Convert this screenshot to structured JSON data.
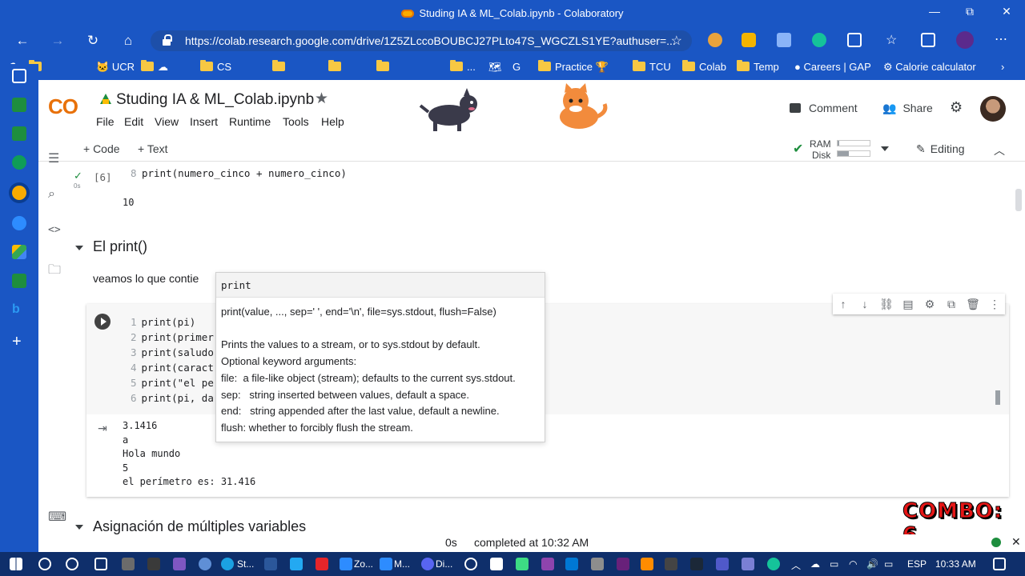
{
  "window": {
    "title": "Studing IA & ML_Colab.ipynb - Colaboratory",
    "minimize": "—",
    "restore": "⧉",
    "close": "✕"
  },
  "browser": {
    "url": "https://colab.research.google.com/drive/1Z5ZLccoBOUBCJ27PLto47S_WGCZLS1YE?authuser=...",
    "bookmarks": [
      "UCR",
      "CS",
      "...",
      "Practice",
      "TCU",
      "Colab",
      "Temp",
      "Careers | GAP",
      "Calorie calculator"
    ]
  },
  "colab": {
    "logo": "CO",
    "notebook_title": "Studing IA & ML_Colab.ipynb",
    "menu": [
      "File",
      "Edit",
      "View",
      "Insert",
      "Runtime",
      "Tools",
      "Help"
    ],
    "comment": "Comment",
    "share": "Share",
    "add_code": "+ Code",
    "add_text": "+ Text",
    "ram_label": "RAM",
    "disk_label": "Disk",
    "ram_level": 0.05,
    "disk_level": 0.35,
    "editing": "Editing"
  },
  "notebook": {
    "prev_cell_exec": "[6]",
    "prev_cell_time": "0s",
    "prev_cell_line_no": "8",
    "prev_cell_code": "print(numero_cinco + numero_cinco)",
    "prev_output": "10",
    "section1": "El print()",
    "section1_text": "veamos lo que contie",
    "code_lines": [
      {
        "n": "1",
        "code": "print(pi)"
      },
      {
        "n": "2",
        "code": "print(primer"
      },
      {
        "n": "3",
        "code": "print(saludo"
      },
      {
        "n": "4",
        "code": "print(caract"
      },
      {
        "n": "5",
        "code": "print(\"el pe"
      },
      {
        "n": "6",
        "code": "print(pi, da"
      }
    ],
    "outputs": [
      "3.1416",
      "a",
      "Hola mundo",
      "5",
      "el perímetro es: 31.416"
    ],
    "section2": "Asignación de múltiples variables"
  },
  "tooltip": {
    "name": "print",
    "lines": [
      "print(value, ..., sep=' ', end='\\n', file=sys.stdout, flush=False)",
      "",
      "Prints the values to a stream, or to sys.stdout by default.",
      "Optional keyword arguments:",
      "file:  a file-like object (stream); defaults to the current sys.stdout.",
      "sep:   string inserted between values, default a space.",
      "end:   string appended after the last value, default a newline.",
      "flush: whether to forcibly flush the stream."
    ]
  },
  "status": {
    "time": "0s",
    "completed": "completed at 10:32 AM"
  },
  "overlay": {
    "combo": "COMBO: 6"
  },
  "taskbar": {
    "items": [
      "St...",
      "Zo...",
      "M...",
      "Di..."
    ],
    "lang": "ESP",
    "clock": "10:33 AM"
  }
}
